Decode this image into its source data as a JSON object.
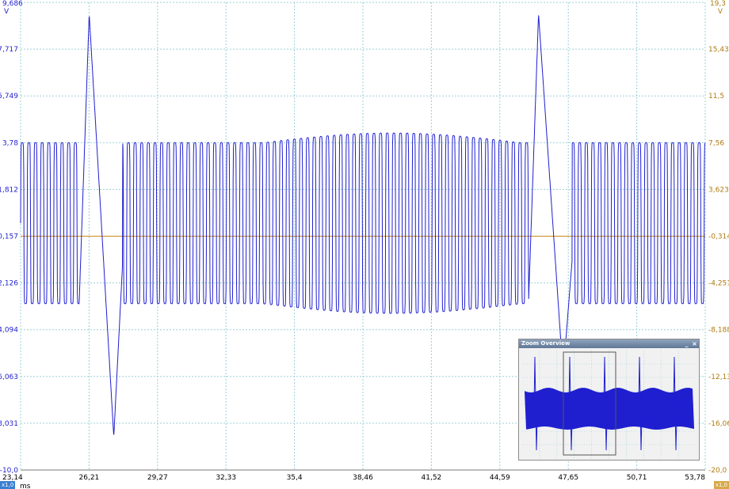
{
  "left_axis": {
    "unit": "V",
    "top_label": "9,686",
    "ticks": [
      "7,717",
      "5,749",
      "3,78",
      "1,812",
      "-0,157",
      "-2,126",
      "-4,094",
      "-6,063",
      "-8,031",
      "-10,0"
    ],
    "color": "#1f1fd0"
  },
  "right_axis": {
    "unit": "V",
    "top_label": "19,3",
    "ticks": [
      "15,43",
      "11,5",
      "7,56",
      "3,623",
      "-0,314",
      "-4,251",
      "-8,188",
      "-12,13",
      "-16,06",
      "-20,0"
    ],
    "color": "#b07a12"
  },
  "x_axis": {
    "unit": "ms",
    "ticks": [
      "23,14",
      "26,21",
      "29,27",
      "32,33",
      "35,4",
      "38,46",
      "41,52",
      "44,59",
      "47,65",
      "50,71",
      "53,78"
    ]
  },
  "chips": {
    "left": "x1,0",
    "right": "x1,0"
  },
  "zoom_overview": {
    "title": "Zoom Overview",
    "minimize": "_",
    "close": "×"
  },
  "colors": {
    "trace": "#1f1fd0",
    "reference": "#c98a1a",
    "grid": "#9ad0d8"
  },
  "chart_data": {
    "type": "line",
    "x_range_ms": [
      23.14,
      53.78
    ],
    "y_range_v": [
      -10.0,
      9.686
    ],
    "reference_level_v": -0.157,
    "oscillation": {
      "high_v": 3.78,
      "low_v": -3.0,
      "period_ms": 0.297
    },
    "spikes": [
      {
        "t_ms": 26.21,
        "peak_v": 9.2,
        "trough_v": -8.6
      },
      {
        "t_ms": 46.32,
        "peak_v": 9.2,
        "trough_v": -6.0
      }
    ]
  }
}
